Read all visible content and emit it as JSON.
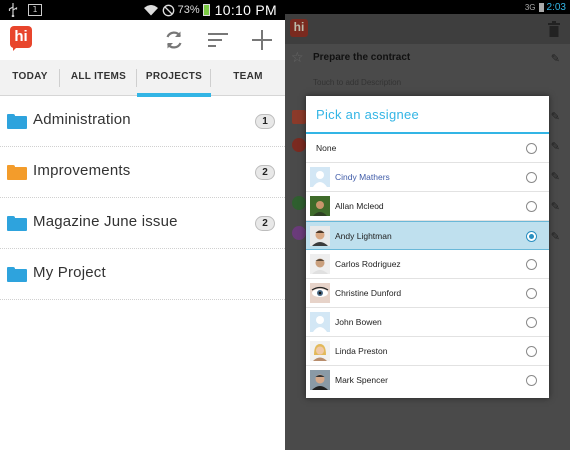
{
  "left": {
    "status_bar": {
      "card_glyph": "1",
      "battery_percent": "73%",
      "time": "10:10 PM",
      "icons": [
        "usb-icon",
        "sd-card-icon",
        "wifi-icon",
        "no-sound-icon",
        "battery-icon"
      ]
    },
    "toolbar": {
      "logo_text": "hi",
      "actions": [
        "refresh-icon",
        "sort-icon",
        "add-icon"
      ]
    },
    "tabs": [
      {
        "label": "TODAY",
        "active": false
      },
      {
        "label": "ALL ITEMS",
        "active": false
      },
      {
        "label": "PROJECTS",
        "active": true
      },
      {
        "label": "TEAM",
        "active": false
      }
    ],
    "projects": [
      {
        "name": "Administration",
        "count": "1",
        "folder_color": "#2ea3dd"
      },
      {
        "name": "Improvements",
        "count": "2",
        "folder_color": "#f39c2b"
      },
      {
        "name": "Magazine June issue",
        "count": "2",
        "folder_color": "#2ea3dd"
      },
      {
        "name": "My Project",
        "count": "",
        "folder_color": "#2ea3dd"
      }
    ]
  },
  "right": {
    "status_bar": {
      "signal_text": "3G",
      "time": "2:03"
    },
    "toolbar": {
      "logo_text": "hi",
      "actions": [
        "trash-icon"
      ]
    },
    "background_task": {
      "title": "Prepare the contract",
      "description_placeholder": "Touch to add Description"
    },
    "dialog": {
      "title": "Pick an assignee",
      "options": [
        {
          "name": "None",
          "selected": false,
          "avatar": "none"
        },
        {
          "name": "Cindy Mathers",
          "selected": false,
          "avatar": "default"
        },
        {
          "name": "Allan Mcleod",
          "selected": false,
          "avatar": "photo"
        },
        {
          "name": "Andy Lightman",
          "selected": true,
          "avatar": "photo"
        },
        {
          "name": "Carlos Rodriguez",
          "selected": false,
          "avatar": "photo"
        },
        {
          "name": "Christine Dunford",
          "selected": false,
          "avatar": "photo"
        },
        {
          "name": "John Bowen",
          "selected": false,
          "avatar": "default"
        },
        {
          "name": "Linda Preston",
          "selected": false,
          "avatar": "photo"
        },
        {
          "name": "Mark Spencer",
          "selected": false,
          "avatar": "photo"
        }
      ]
    }
  },
  "colors": {
    "accent": "#33b5e5",
    "brand_red": "#e8452c",
    "selected_row": "#bfe0ee"
  }
}
